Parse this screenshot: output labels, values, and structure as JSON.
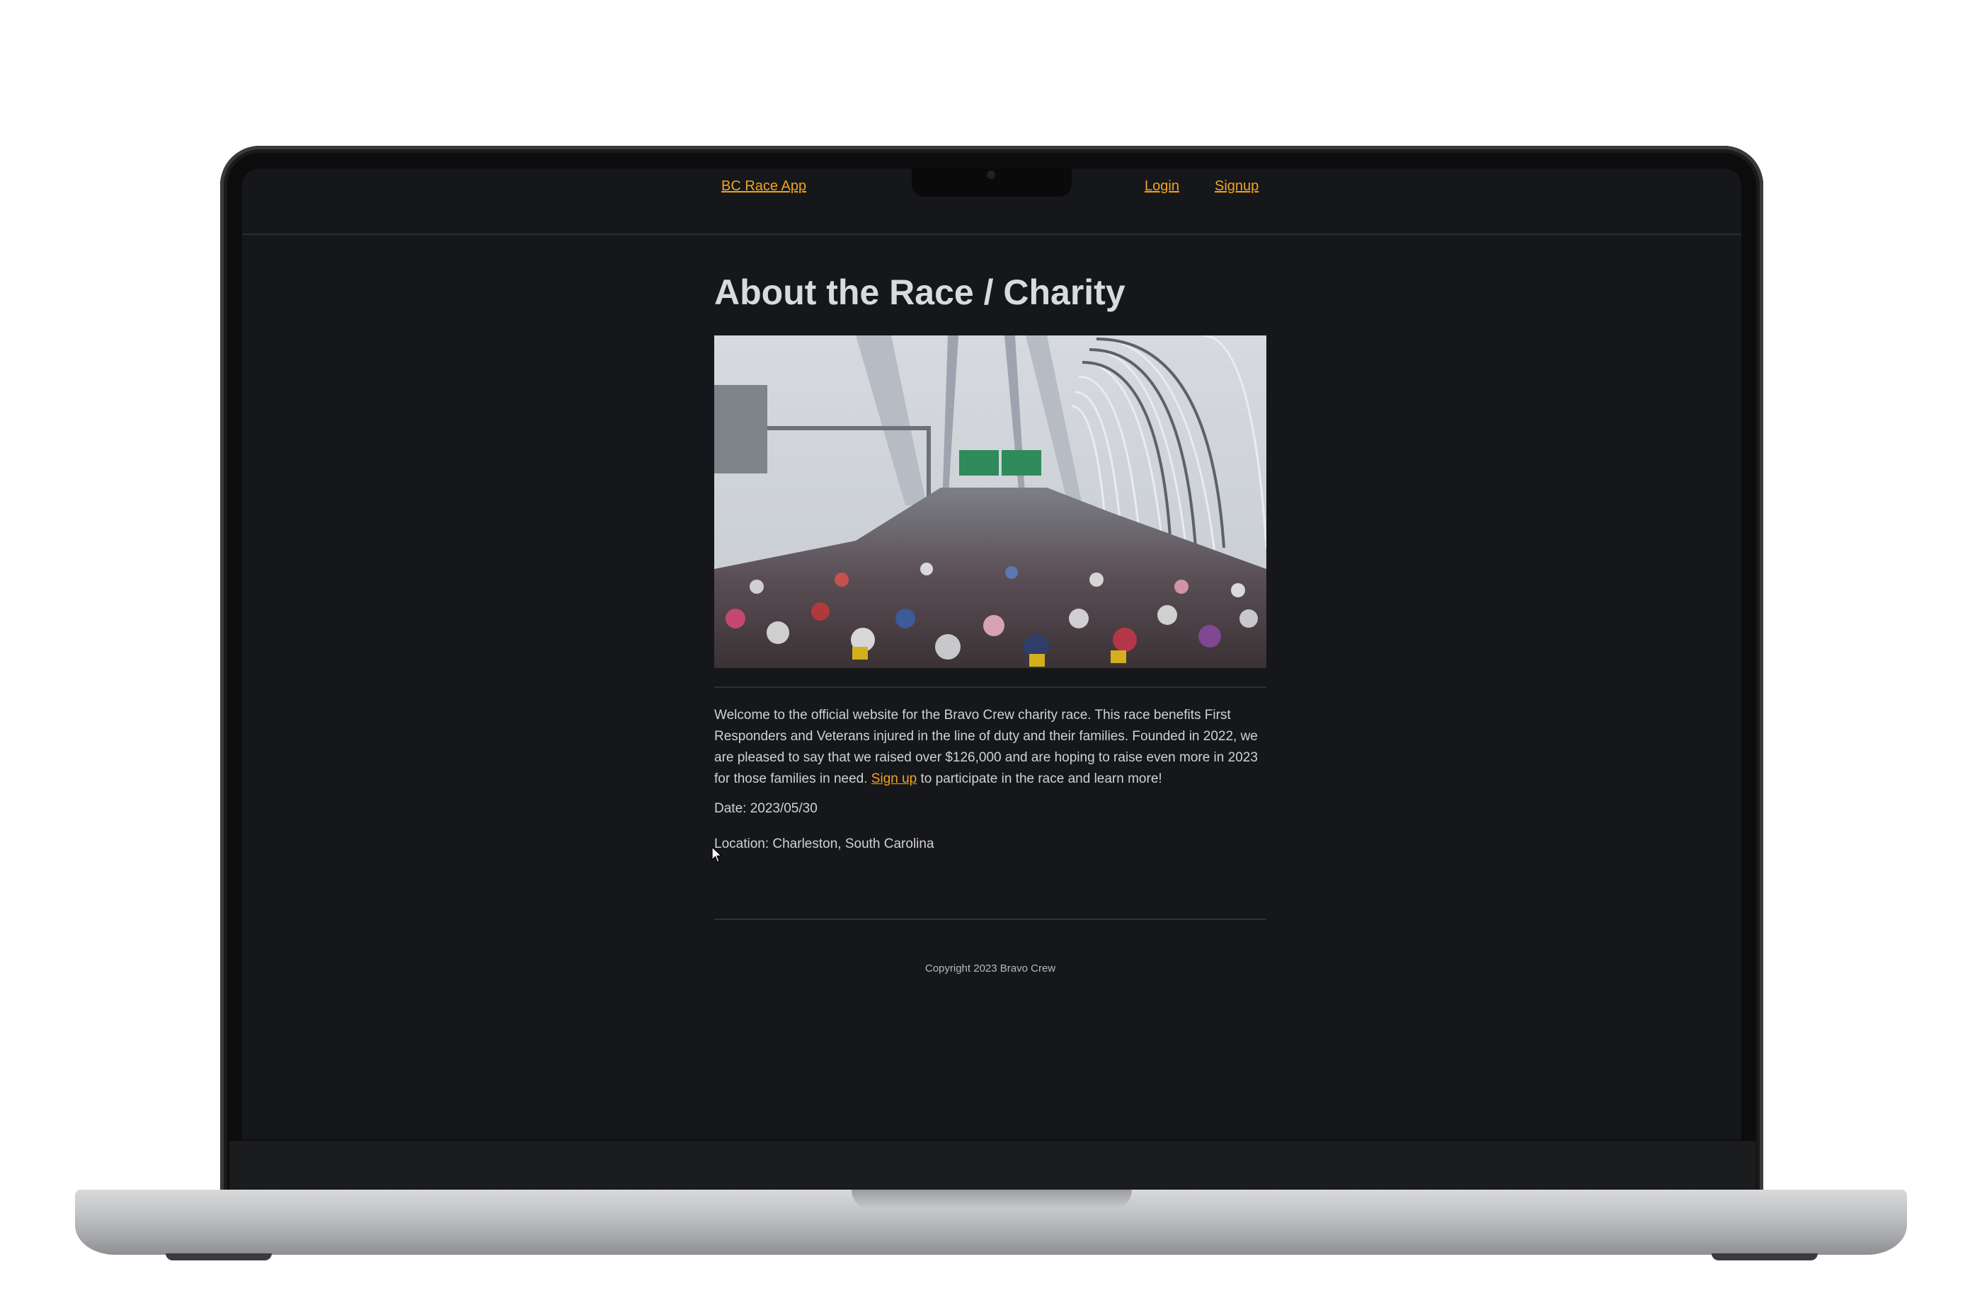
{
  "nav": {
    "brand": "BC Race App",
    "login": "Login",
    "signup": "Signup"
  },
  "main": {
    "title": "About the Race / Charity",
    "intro_before": "Welcome to the official website for the Bravo Crew charity race. This race benefits First Responders and Veterans injured in the line of duty and their families. Founded in 2022, we are pleased to say that we raised over $126,000 and are hoping to raise even more in 2023 for those families in need. ",
    "intro_link": "Sign up",
    "intro_after": " to participate in the race and learn more!",
    "date": "Date: 2023/05/30",
    "location": "Location: Charleston, South Carolina"
  },
  "footer": {
    "copyright": "Copyright 2023 Bravo Crew"
  },
  "colors": {
    "accent": "#f0a421",
    "background": "#16171a",
    "text": "#d0d1d3"
  }
}
